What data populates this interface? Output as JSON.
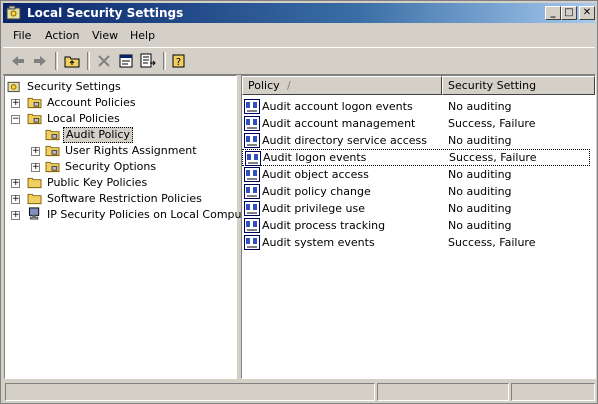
{
  "window": {
    "title": "Local Security Settings"
  },
  "controls": {
    "minimize": "_",
    "maximize": "□",
    "close": "✕"
  },
  "menu": {
    "file": "File",
    "action": "Action",
    "view": "View",
    "help": "Help"
  },
  "toolbar": {
    "icons": [
      "back-icon",
      "forward-icon",
      "up-folder-icon",
      "delete-icon",
      "properties-icon",
      "export-list-icon",
      "help-icon"
    ]
  },
  "tree": {
    "root": "Security Settings",
    "account_policies": "Account Policies",
    "local_policies": "Local Policies",
    "audit_policy": "Audit Policy",
    "user_rights": "User Rights Assignment",
    "security_options": "Security Options",
    "public_key": "Public Key Policies",
    "software_restriction": "Software Restriction Policies",
    "ip_security": "IP Security Policies on Local Computer"
  },
  "list": {
    "columns": {
      "policy": "Policy",
      "sort_indicator": "/",
      "setting": "Security Setting"
    },
    "rows": [
      {
        "policy": "Audit account logon events",
        "setting": "No auditing"
      },
      {
        "policy": "Audit account management",
        "setting": "Success, Failure"
      },
      {
        "policy": "Audit directory service access",
        "setting": "No auditing"
      },
      {
        "policy": "Audit logon events",
        "setting": "Success, Failure"
      },
      {
        "policy": "Audit object access",
        "setting": "No auditing"
      },
      {
        "policy": "Audit policy change",
        "setting": "No auditing"
      },
      {
        "policy": "Audit privilege use",
        "setting": "No auditing"
      },
      {
        "policy": "Audit process tracking",
        "setting": "No auditing"
      },
      {
        "policy": "Audit system events",
        "setting": "Success, Failure"
      }
    ]
  },
  "colors": {
    "title_start": "#0a246a",
    "title_end": "#a6caf0",
    "face": "#d4d0c8"
  }
}
